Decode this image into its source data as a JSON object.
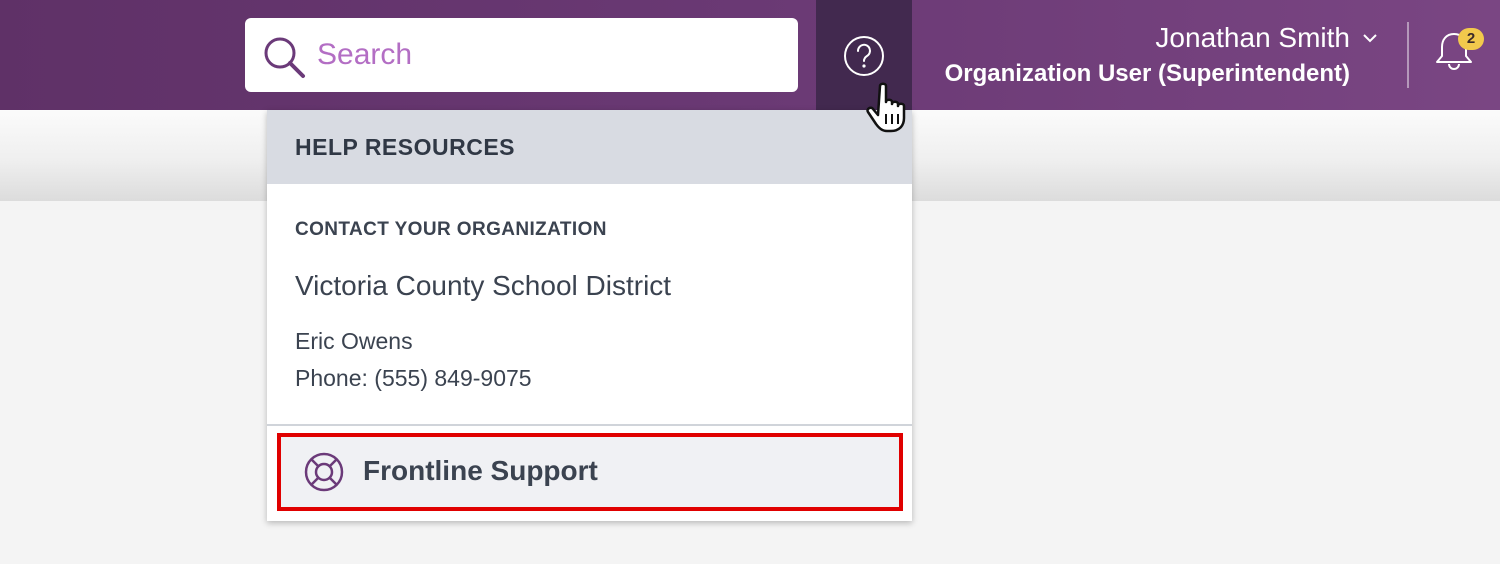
{
  "header": {
    "search": {
      "placeholder": "Search"
    },
    "user": {
      "name": "Jonathan Smith",
      "role": "Organization User (Superintendent)"
    },
    "notifications": {
      "count": "2"
    },
    "icons": {
      "search": "search-icon",
      "help": "help-question-icon",
      "chevron": "chevron-down-icon",
      "bell": "bell-icon",
      "cursor": "hand-pointer-cursor-icon"
    }
  },
  "help_menu": {
    "title": "HELP RESOURCES",
    "contact_heading": "CONTACT YOUR ORGANIZATION",
    "organization": "Victoria County School District",
    "contact_name": "Eric Owens",
    "contact_phone": "Phone: (555) 849-9075",
    "support_link": {
      "label": "Frontline Support",
      "icon": "lifebuoy-icon"
    }
  },
  "colors": {
    "header_bg": "#6a3974",
    "help_button_active_bg": "#42294f",
    "accent_purple": "#a254b4",
    "badge_bg": "#f2c94c",
    "highlight_outline": "#e00000",
    "menu_header_bg": "#d8dbe2",
    "text_dark": "#3b4350"
  }
}
